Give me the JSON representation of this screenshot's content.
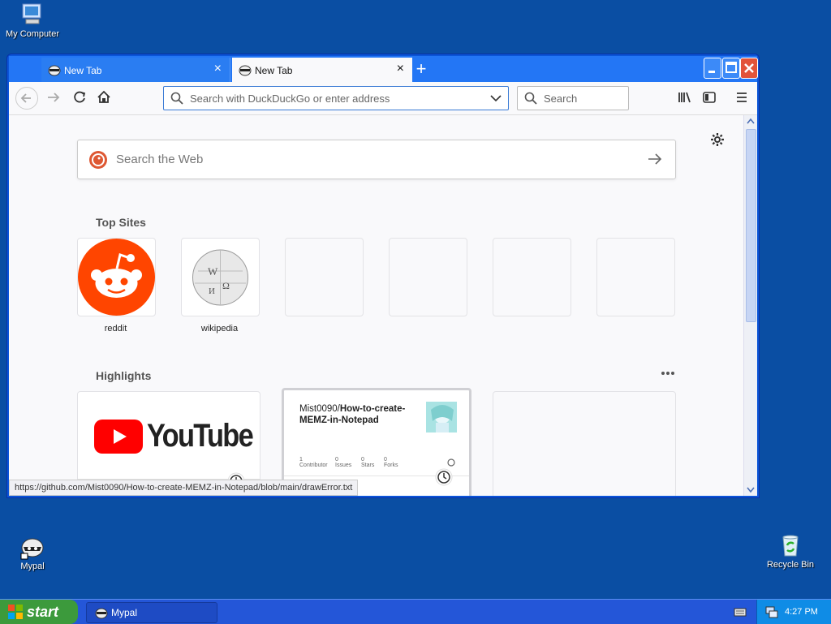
{
  "desktop": {
    "icons": [
      {
        "label": "My Computer"
      },
      {
        "label": "Mypal"
      },
      {
        "label": "Recycle Bin"
      }
    ]
  },
  "browser": {
    "tabs": [
      {
        "label": "New Tab",
        "active": false
      },
      {
        "label": "New Tab",
        "active": true
      }
    ],
    "urlbar_placeholder": "Search with DuckDuckGo or enter address",
    "searchbar_placeholder": "Search",
    "newtab": {
      "search_placeholder": "Search the Web",
      "top_sites_title": "Top Sites",
      "top_sites": [
        {
          "label": "reddit",
          "icon": "reddit-icon"
        },
        {
          "label": "wikipedia",
          "icon": "wikipedia-icon"
        },
        {
          "label": ""
        },
        {
          "label": ""
        },
        {
          "label": ""
        },
        {
          "label": ""
        }
      ],
      "highlights_title": "Highlights",
      "highlights": [
        {
          "type": "youtube",
          "logo_text": "YouTube"
        },
        {
          "type": "github",
          "repo_owner": "Mist0090/",
          "repo_name": "How-to-create-MEMZ-in-Notepad",
          "stats": [
            "1",
            "0",
            "0",
            "0"
          ],
          "stat_labels": [
            "Contributor",
            "Issues",
            "Stars",
            "Forks"
          ]
        },
        {
          "type": "empty"
        }
      ]
    },
    "status_url": "https://github.com/Mist0090/How-to-create-MEMZ-in-Notepad/blob/main/drawError.txt"
  },
  "taskbar": {
    "start_label": "start",
    "task_label": "Mypal",
    "clock": "4:27 PM"
  },
  "colors": {
    "desktop": "#0a4ea3",
    "titlebar": "#2376f5",
    "reddit": "#ff4500",
    "youtube": "#ff0000",
    "start": "#3c9a3c"
  }
}
